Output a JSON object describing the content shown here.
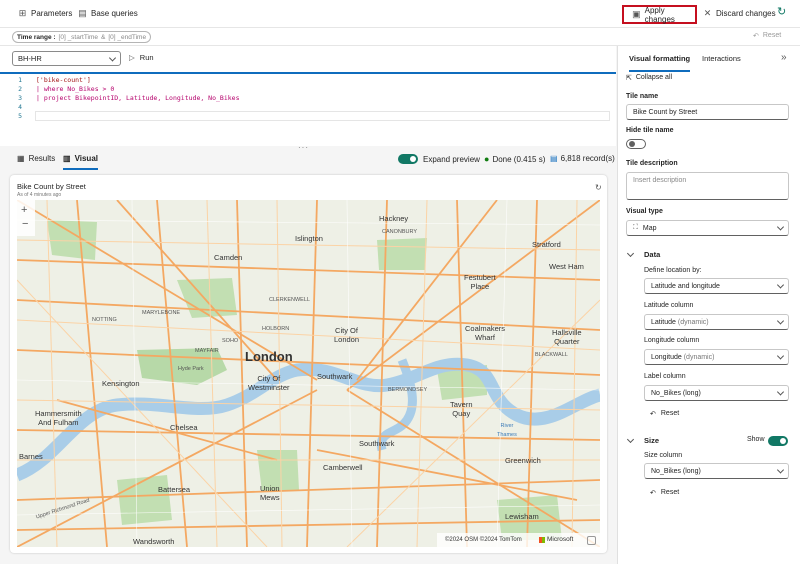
{
  "toolbar": {
    "parameters": "Parameters",
    "base_queries": "Base queries",
    "apply": "Apply changes",
    "discard": "Discard changes"
  },
  "timebar": {
    "label": "Time range :",
    "start": "[0] _startTime",
    "amp": "&",
    "end": "[0] _endTime",
    "reset": "Reset"
  },
  "editor": {
    "database": "BH-HR",
    "run": "Run",
    "lines": [
      {
        "n": "1",
        "text": "['bike-count']"
      },
      {
        "n": "2",
        "text": "| where No_Bikes > 0"
      },
      {
        "n": "3",
        "text": "| project BikepointID, Latitude, Longitude, No_Bikes"
      },
      {
        "n": "4",
        "text": ""
      },
      {
        "n": "5",
        "text": ""
      }
    ]
  },
  "results_bar": {
    "results_tab": "Results",
    "visual_tab": "Visual",
    "expand_preview": "Expand preview",
    "done": "Done (0.415 s)",
    "records": "6,818 record(s)"
  },
  "tile": {
    "title": "Bike Count by Street",
    "subtitle": "As of 4 minutes ago",
    "attribution": "©2024 OSM ©2024 TomTom",
    "microsoft": "Microsoft",
    "zoom_in": "+",
    "zoom_out": "−"
  },
  "map_labels": {
    "hackney": "Hackney",
    "islington": "Islington",
    "stratford": "Stratford",
    "camden": "Camden",
    "west_ham": "West Ham",
    "festubert": "Festubert\nPlace",
    "city_of_london": "City Of\nLondon",
    "coalmakers": "Coalmakers\nWharf",
    "hallsville": "Hallsville\nQuarter",
    "london": "London",
    "kensington": "Kensington",
    "city_westminster": "City Of\nWestminster",
    "southwark": "Southwark",
    "hammersmith": "Hammersmith\nAnd Fulham",
    "tavern_quay": "Tavern\nQuay",
    "chelsea": "Chelsea",
    "southwark2": "Southwark",
    "greenwich": "Greenwich",
    "barnes": "Barnes",
    "camberwell": "Camberwell",
    "union_mews": "Union\nMews",
    "battersea": "Battersea",
    "lewisham": "Lewisham",
    "wandsworth": "Wandsworth",
    "hyde_park": "Hyde Park",
    "marylebone": "MARYLEBONE",
    "clerkenwell": "CLERKENWELL",
    "holborn": "HOLBORN",
    "mayfair": "MAYFAIR",
    "soho": "SOHO",
    "bermondsey": "BERMONDSEY",
    "blackwall": "BLACKWALL",
    "notting": "NOTTING",
    "canonbury": "CANONBURY",
    "thames": "River\nThames",
    "upper_richmond": "Upper Richmond Road"
  },
  "panel": {
    "tab_visual": "Visual formatting",
    "tab_interactions": "Interactions",
    "collapse_all": "Collapse all",
    "tile_name_label": "Tile name",
    "tile_name_value": "Bike Count by Street",
    "hide_tile_name": "Hide tile name",
    "tile_description": "Tile description",
    "description_placeholder": "Insert description",
    "visual_type_label": "Visual type",
    "visual_type_value": "Map",
    "data_section": "Data",
    "define_location": "Define location by:",
    "define_location_value": "Latitude and longitude",
    "lat_label": "Latitude column",
    "lat_value": "Latitude",
    "lat_type": "(dynamic)",
    "lon_label": "Longitude column",
    "lon_value": "Longitude",
    "lon_type": "(dynamic)",
    "label_col_label": "Label column",
    "label_col_value": "No_Bikes (long)",
    "reset": "Reset",
    "size_section": "Size",
    "show": "Show",
    "size_col_label": "Size column",
    "size_col_value": "No_Bikes (long)"
  },
  "colors": {
    "accent": "#0f6cbd",
    "apply_border": "#c50f1f",
    "toggle_on": "#117865",
    "river": "#a9cde8",
    "park": "#b7d9a8",
    "road": "#f4a862"
  }
}
